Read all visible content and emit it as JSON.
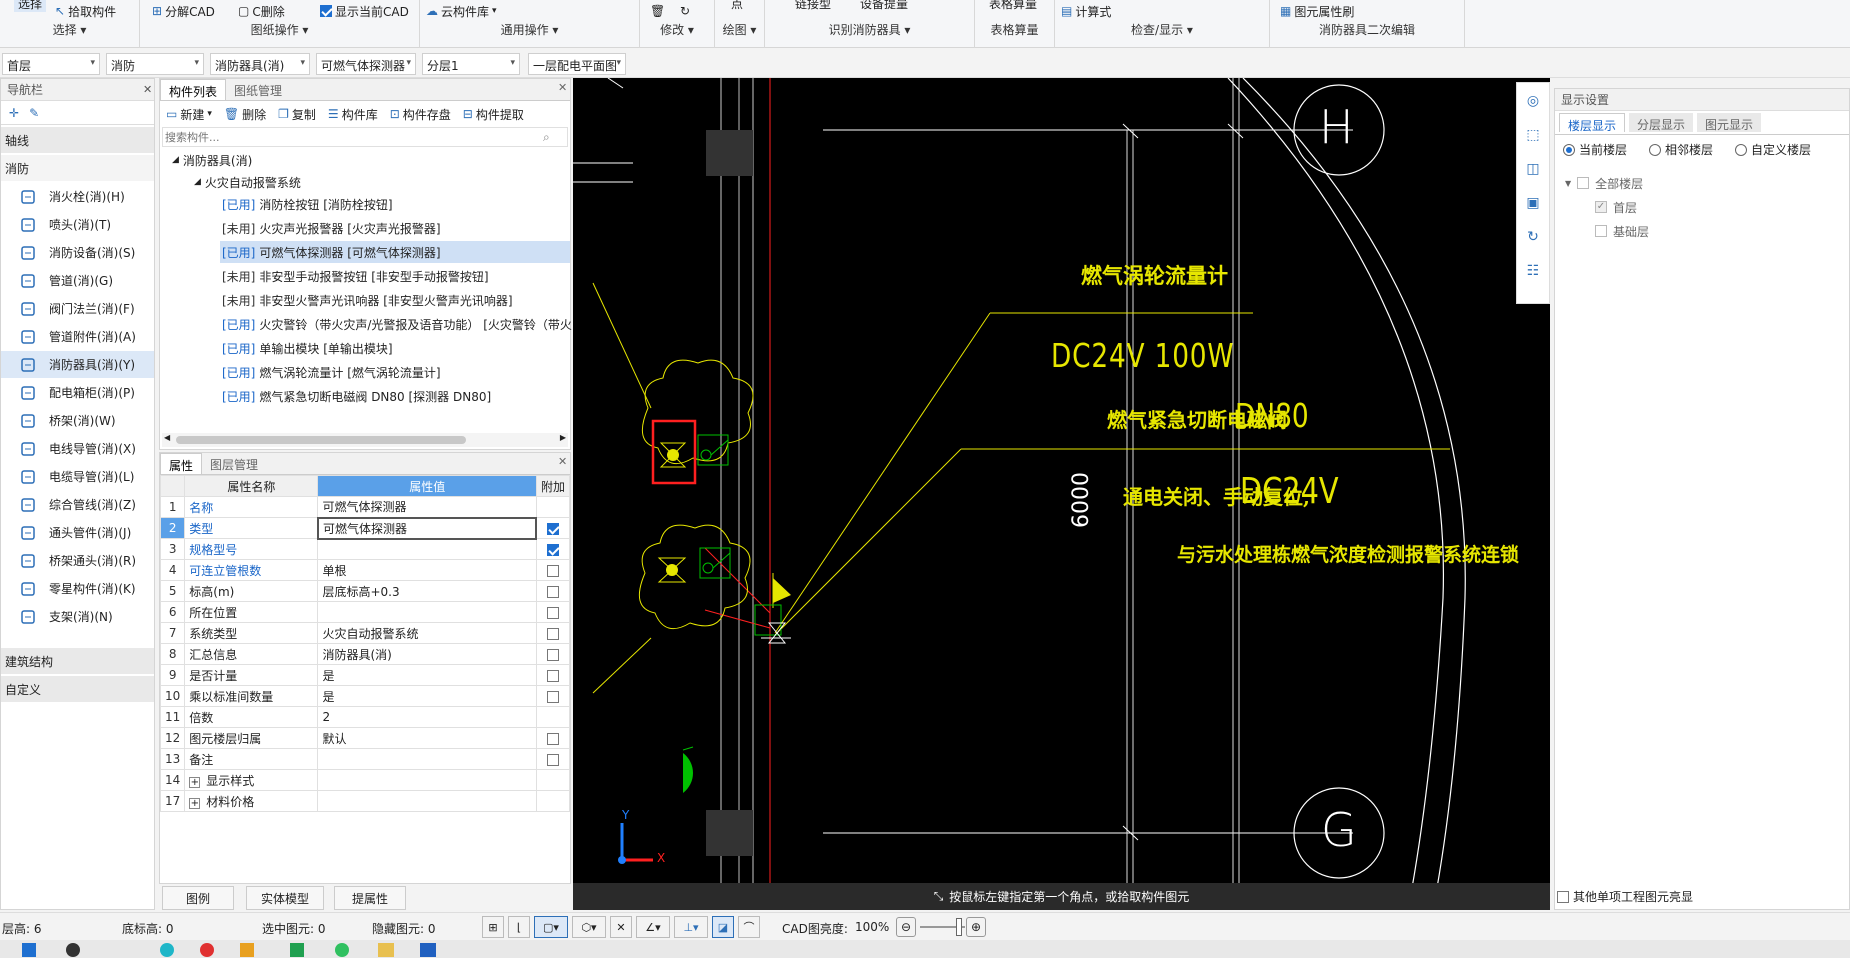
{
  "ribbon": {
    "groups": [
      {
        "name": "选择",
        "items": [
          "选择",
          "拾取构件"
        ]
      },
      {
        "name": "图纸操作",
        "items": [
          "分解CAD",
          "C删除",
          "显示当前CAD"
        ]
      },
      {
        "name": "通用操作",
        "items": [
          "云构件库"
        ]
      },
      {
        "name": "修改",
        "items": []
      },
      {
        "name": "绘图",
        "items": [
          "点"
        ]
      },
      {
        "name": "识别消防器具",
        "items": [
          "链接型",
          "设备提量"
        ]
      },
      {
        "name": "表格算量",
        "items": [
          "表格算量"
        ]
      },
      {
        "name": "检查/显示",
        "items": [
          "计算式"
        ]
      },
      {
        "name": "消防器具二次编辑",
        "items": [
          "图元属性刷"
        ]
      }
    ],
    "show_current_cad_checked": true
  },
  "toolbar2": {
    "floor": "首层",
    "specialty": "消防",
    "type": "消防器具(消)",
    "component": "可燃气体探测器",
    "layer": "分层1",
    "drawing": "一层配电平面图"
  },
  "nav": {
    "title": "导航栏",
    "sections": [
      "轴线",
      "消防",
      "建筑结构",
      "自定义"
    ],
    "items": [
      {
        "label": "消火栓(消)(H)",
        "icon": "hydrant-icon"
      },
      {
        "label": "喷头(消)(T)",
        "icon": "sprinkler-icon"
      },
      {
        "label": "消防设备(消)(S)",
        "icon": "fire-equipment-icon"
      },
      {
        "label": "管道(消)(G)",
        "icon": "pipe-icon"
      },
      {
        "label": "阀门法兰(消)(F)",
        "icon": "valve-icon"
      },
      {
        "label": "管道附件(消)(A)",
        "icon": "pipe-fitting-icon"
      },
      {
        "label": "消防器具(消)(Y)",
        "icon": "alarm-device-icon"
      },
      {
        "label": "配电箱柜(消)(P)",
        "icon": "panel-box-icon"
      },
      {
        "label": "桥架(消)(W)",
        "icon": "tray-icon"
      },
      {
        "label": "电线导管(消)(X)",
        "icon": "wire-conduit-icon"
      },
      {
        "label": "电缆导管(消)(L)",
        "icon": "cable-conduit-icon"
      },
      {
        "label": "综合管线(消)(Z)",
        "icon": "combined-pipe-icon"
      },
      {
        "label": "通头管件(消)(J)",
        "icon": "tee-fitting-icon"
      },
      {
        "label": "桥架通头(消)(R)",
        "icon": "tray-tee-icon"
      },
      {
        "label": "零星构件(消)(K)",
        "icon": "misc-component-icon"
      },
      {
        "label": "支架(消)(N)",
        "icon": "bracket-icon"
      }
    ]
  },
  "complist": {
    "tabs": [
      "构件列表",
      "图纸管理"
    ],
    "toolbar": [
      "新建",
      "删除",
      "复制",
      "构件库",
      "构件存盘",
      "构件提取"
    ],
    "search_placeholder": "搜索构件...",
    "root": "消防器具(消)",
    "group": "火灾自动报警系统",
    "items": [
      {
        "status": "[已用]",
        "text": "消防栓按钮 [消防栓按钮]"
      },
      {
        "status": "[未用]",
        "text": "火灾声光报警器 [火灾声光报警器]"
      },
      {
        "status": "[已用]",
        "text": "可燃气体探测器 [可燃气体探测器]"
      },
      {
        "status": "[未用]",
        "text": "非安型手动报警按钮 [非安型手动报警按钮]"
      },
      {
        "status": "[未用]",
        "text": "非安型火警声光讯响器 [非安型火警声光讯响器]"
      },
      {
        "status": "[已用]",
        "text": "火灾警铃（带火灾声/光警报及语音功能） [火灾警铃（带火"
      },
      {
        "status": "[已用]",
        "text": "单输出模块 [单输出模块]"
      },
      {
        "status": "[已用]",
        "text": "燃气涡轮流量计 [燃气涡轮流量计]"
      },
      {
        "status": "[已用]",
        "text": "燃气紧急切断电磁阀 DN80 [探测器 DN80]"
      }
    ]
  },
  "props": {
    "tabs": [
      "属性",
      "图层管理"
    ],
    "headers": [
      "属性名称",
      "属性值",
      "附加"
    ],
    "rows": [
      {
        "n": "1",
        "name": "名称",
        "value": "可燃气体探测器",
        "blue": true,
        "cb": null
      },
      {
        "n": "2",
        "name": "类型",
        "value": "可燃气体探测器",
        "blue": true,
        "cb": true
      },
      {
        "n": "3",
        "name": "规格型号",
        "value": "",
        "blue": true,
        "cb": true
      },
      {
        "n": "4",
        "name": "可连立管根数",
        "value": "单根",
        "blue": true,
        "cb": false
      },
      {
        "n": "5",
        "name": "标高(m)",
        "value": "层底标高+0.3",
        "blue": false,
        "cb": false
      },
      {
        "n": "6",
        "name": "所在位置",
        "value": "",
        "blue": false,
        "cb": false
      },
      {
        "n": "7",
        "name": "系统类型",
        "value": "火灾自动报警系统",
        "blue": false,
        "cb": false
      },
      {
        "n": "8",
        "name": "汇总信息",
        "value": "消防器具(消)",
        "blue": false,
        "cb": false
      },
      {
        "n": "9",
        "name": "是否计量",
        "value": "是",
        "blue": false,
        "cb": false
      },
      {
        "n": "10",
        "name": "乘以标准间数量",
        "value": "是",
        "blue": false,
        "cb": false
      },
      {
        "n": "11",
        "name": "倍数",
        "value": "2",
        "blue": false,
        "cb": null
      },
      {
        "n": "12",
        "name": "图元楼层归属",
        "value": "默认",
        "blue": false,
        "cb": false
      },
      {
        "n": "13",
        "name": "备注",
        "value": "",
        "blue": false,
        "cb": false
      },
      {
        "n": "14",
        "name": "显示样式",
        "value": "",
        "blue": false,
        "cb": null,
        "expand": true
      },
      {
        "n": "17",
        "name": "材料价格",
        "value": "",
        "blue": false,
        "cb": null,
        "expand": true
      }
    ],
    "bottom_buttons": [
      "图例",
      "实体模型",
      "提属性"
    ]
  },
  "cad": {
    "labels": {
      "flowmeter": "燃气涡轮流量计",
      "dc100": "DC24V 100W",
      "valve": "燃气紧急切断电磁阀",
      "dn80": "DN80",
      "dim": "6000",
      "power": "通电关闭、手动复位,",
      "dc": "DC24V",
      "link": "与污水处理栋燃气浓度检测报警系统连锁",
      "axisH": "H",
      "axisG": "G"
    },
    "hint": "按鼠标左键指定第一个角点，或拾取构件图元"
  },
  "display": {
    "title": "显示设置",
    "tabs": [
      "楼层显示",
      "分层显示",
      "图元显示"
    ],
    "radios": [
      "当前楼层",
      "相邻楼层",
      "自定义楼层"
    ],
    "tree": [
      "全部楼层",
      "首层",
      "基础层"
    ],
    "other": "其他单项工程图元亮显"
  },
  "status": {
    "floor_height": "层高: 6",
    "base_height": "底标高: 0",
    "selected": "选中图元: 0",
    "hidden": "隐藏图元: 0",
    "brightness_label": "CAD图亮度:",
    "brightness": "100%"
  },
  "colors": {
    "accent": "#1e6fd0",
    "used": "#1a66c8",
    "cad_yellow": "#e6e600",
    "cad_red": "#ff2020",
    "cad_green": "#00c000"
  }
}
